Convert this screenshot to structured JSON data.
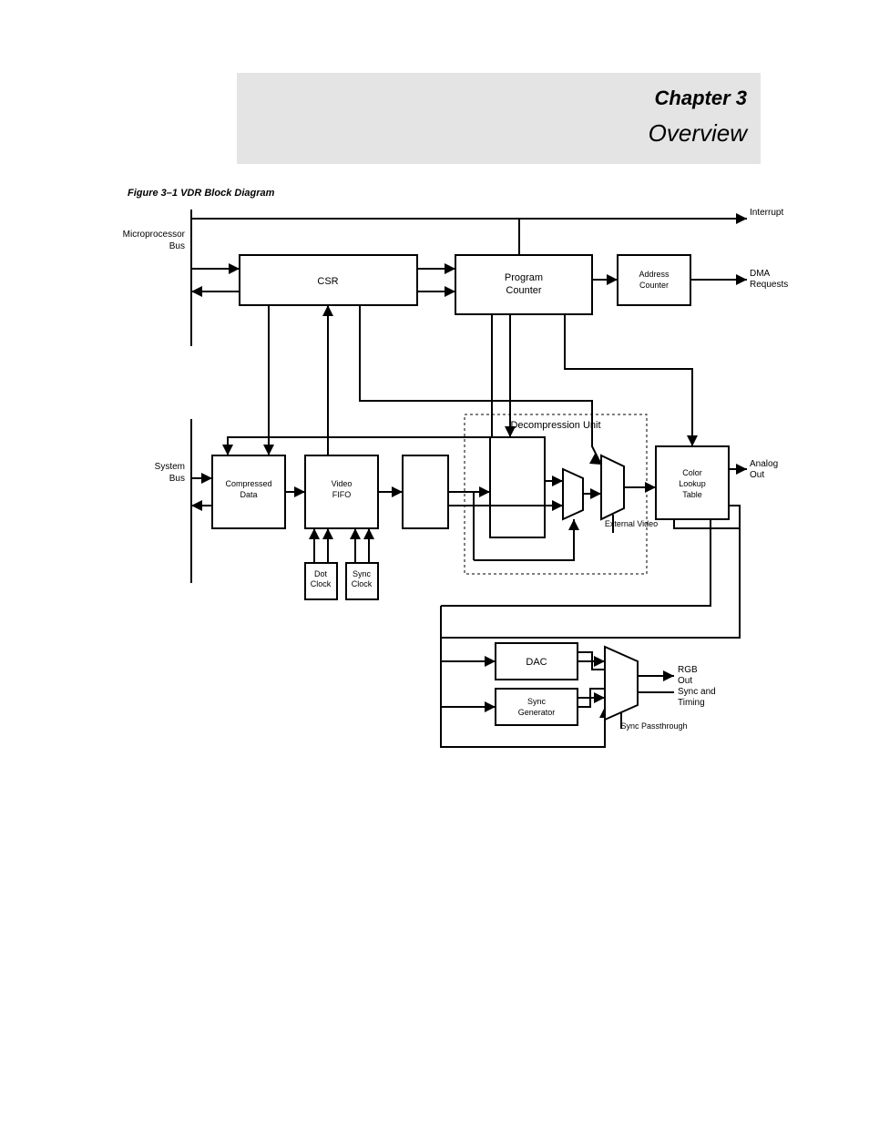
{
  "header": {
    "chapter": "Chapter 3",
    "title": "Overview"
  },
  "fig": {
    "title": "Figure 3–1 VDR Block Diagram"
  },
  "bus": {
    "micro": "Microprocessor Bus",
    "sys": "System Bus"
  },
  "out": {
    "int": "Interrupt",
    "dma": "DMA Requests",
    "ao": "Analog Out",
    "rgb": "RGB Out",
    "sync": "Sync and Timing"
  },
  "blk": {
    "csr": "CSR",
    "pc": "Program Counter",
    "addr": "Address Counter",
    "dclk": "Dot Clock",
    "sclk": "Sync Clock",
    "cmp": "Compressed Data",
    "fifo": "Video FIFO",
    "dcu": "Decompression Unit",
    "clut": "Color Lookup Table",
    "dac": "DAC",
    "sgen": "Sync Generator"
  },
  "mux": {
    "ext": "External Video",
    "pass": "Sync Passthrough"
  }
}
